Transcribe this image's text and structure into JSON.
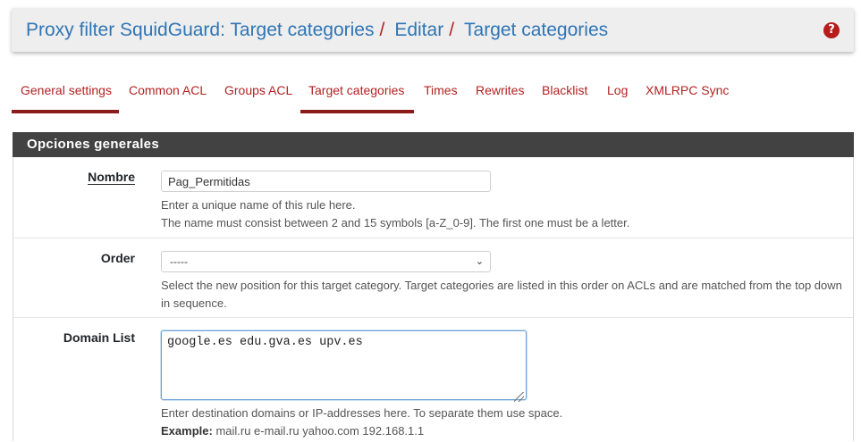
{
  "header": {
    "crumbs": [
      "Proxy filter SquidGuard: Target categories",
      "Editar",
      "Target categories"
    ],
    "separators": [
      "/",
      "/"
    ],
    "help_icon": "question-circle-icon"
  },
  "tabs": [
    {
      "label": "General settings",
      "active": true
    },
    {
      "label": "Common ACL",
      "active": false
    },
    {
      "label": "Groups ACL",
      "active": false
    },
    {
      "label": "Target categories",
      "active": true
    },
    {
      "label": "Times",
      "active": false
    },
    {
      "label": "Rewrites",
      "active": false
    },
    {
      "label": "Blacklist",
      "active": false
    },
    {
      "label": "Log",
      "active": false
    },
    {
      "label": "XMLRPC Sync",
      "active": false
    }
  ],
  "panel": {
    "title": "Opciones generales",
    "name": {
      "label": "Nombre",
      "value": "Pag_Permitidas",
      "help1": "Enter a unique name of this rule here.",
      "help2": "The name must consist between 2 and 15 symbols [a-Z_0-9]. The first one must be a letter."
    },
    "order": {
      "label": "Order",
      "selected": "-----",
      "help": "Select the new position for this target category. Target categories are listed in this order on ACLs and are matched from the top down in sequence."
    },
    "domain": {
      "label": "Domain List",
      "value": "google.es edu.gva.es upv.es",
      "help": "Enter destination domains or IP-addresses here. To separate them use space.",
      "example_label": "Example:",
      "example_value": "mail.ru e-mail.ru yahoo.com 192.168.1.1"
    }
  },
  "colors": {
    "link_blue": "#2f75b5",
    "accent_red": "#b22222",
    "tab_underline": "#8b1a1a",
    "panel_heading_bg": "#424242"
  }
}
